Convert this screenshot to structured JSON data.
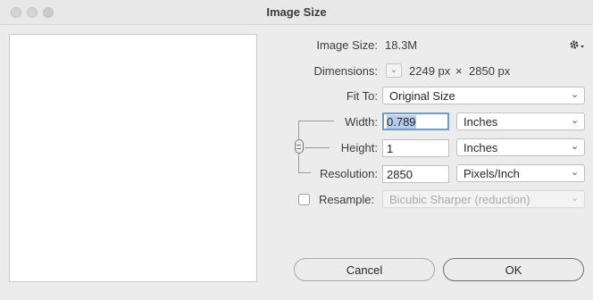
{
  "window": {
    "title": "Image Size"
  },
  "image_size": {
    "label": "Image Size:",
    "value": "18.3M"
  },
  "dimensions": {
    "label": "Dimensions:",
    "width_px": "2249 px",
    "times": "×",
    "height_px": "2850 px"
  },
  "fit_to": {
    "label": "Fit To:",
    "value": "Original Size"
  },
  "width": {
    "label": "Width:",
    "value": "0.789",
    "unit": "Inches"
  },
  "height": {
    "label": "Height:",
    "value": "1",
    "unit": "Inches"
  },
  "resolution": {
    "label": "Resolution:",
    "value": "2850",
    "unit": "Pixels/Inch"
  },
  "resample": {
    "label": "Resample:",
    "checked": false,
    "value": "Bicubic Sharper (reduction)"
  },
  "buttons": {
    "cancel": "Cancel",
    "ok": "OK"
  },
  "icons": {
    "gear": "gear-icon",
    "chevron": "chevron-down-icon",
    "link": "link-chain-icon"
  }
}
